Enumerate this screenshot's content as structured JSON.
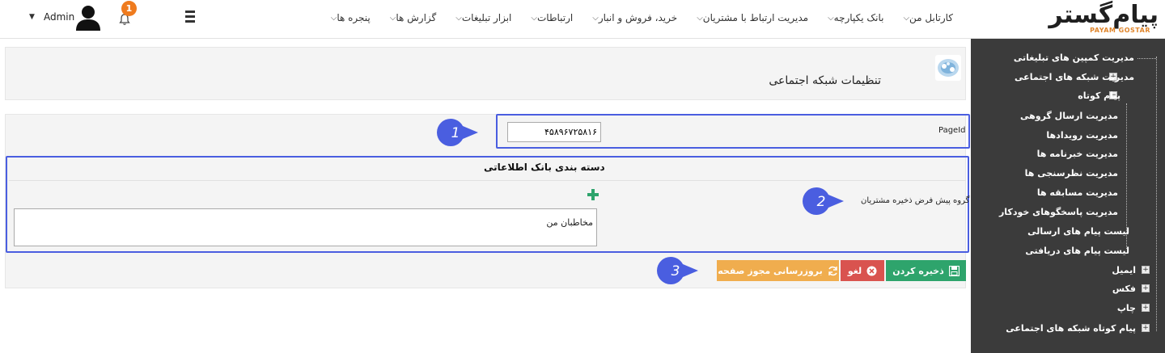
{
  "header": {
    "logo_text": "پیام‌گستر",
    "logo_sub": "PAYAM GOSTAR",
    "menu": [
      "کارتابل من",
      "بانک یکپارچه",
      "مدیریت ارتباط با مشتریان",
      "خرید، فروش و انبار",
      "ارتباطات",
      "ابزار تبلیغات",
      "گزارش ها",
      "پنجره ها"
    ],
    "notification_count": "1",
    "user_name": "Admin"
  },
  "sidebar": {
    "items": [
      "مدیریت کمپین های تبلیغاتی",
      "مدیریت شبکه های اجتماعی",
      "پیام کوتاه",
      "مدیریت ارسال گروهی",
      "مدیریت رویدادها",
      "مدیریت خبرنامه ها",
      "مدیریت نظرسنجی ها",
      "مدیریت مسابقه ها",
      "مدیریت پاسخگوهای خودکار",
      "لیست پیام های ارسالی",
      "لیست پیام های دریافتی",
      "ایمیل",
      "فکس",
      "چاپ",
      "پیام کوتاه شبکه های اجتماعی"
    ]
  },
  "page": {
    "title": "تنظیمات شبکه اجتماعی"
  },
  "form": {
    "pageid_label": "PageId",
    "pageid_value": "۴۵۸۹۶۷۲۵۸۱۶",
    "section_title": "دسته بندی بانک اطلاعاتی",
    "group_label": "گروه پیش فرض ذخیره مشتریان",
    "group_items": [
      "مخاطبان من"
    ]
  },
  "buttons": {
    "save": "ذخیره کردن",
    "cancel": "لغو",
    "refresh": "بروزرسانی مجوز صفحه"
  },
  "callouts": [
    "1",
    "2",
    "3"
  ],
  "colors": {
    "highlight": "#4a5ee0",
    "callout": "#4a5ee0",
    "save": "#2ea46c",
    "cancel": "#d9534f",
    "refresh": "#f0ad4e",
    "sidebar": "#3b3b3b",
    "badge": "#ef7b1e"
  }
}
